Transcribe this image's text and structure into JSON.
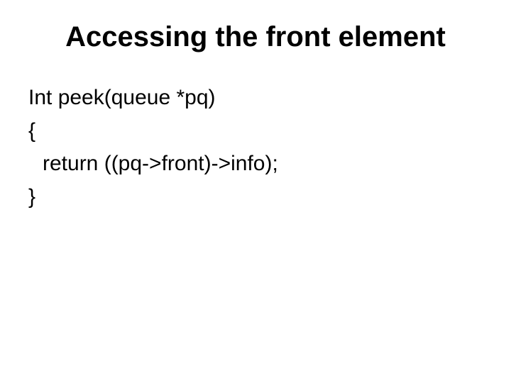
{
  "slide": {
    "title": "Accessing the front element",
    "lines": [
      "Int peek(queue *pq)",
      "{",
      "  return ((pq->front)->info);",
      "}"
    ]
  }
}
